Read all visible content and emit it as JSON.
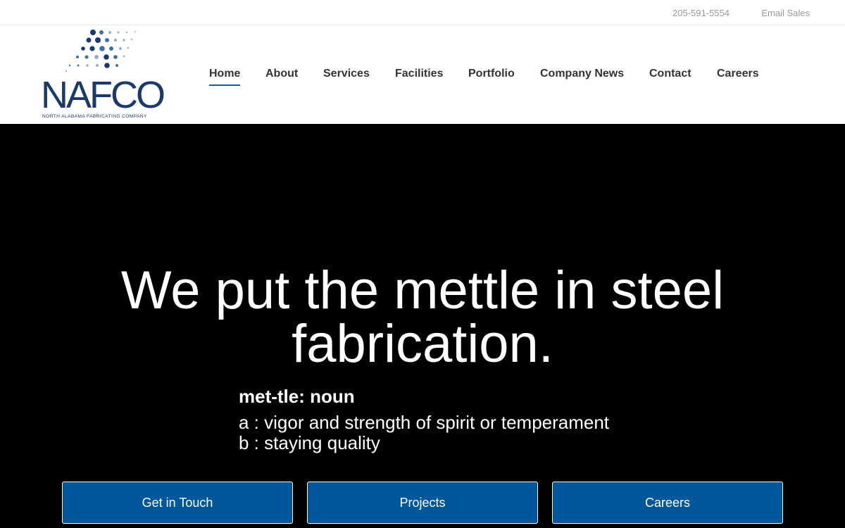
{
  "topbar": {
    "phone": "205-591-5554",
    "email": "Email Sales"
  },
  "logo": {
    "wordmark": "NAFCO",
    "tagline": "NORTH ALABAMA FABRICATING COMPANY",
    "icon": "dot-grid-logo-icon",
    "colors": {
      "dark": "#1a3a6b",
      "medium": "#3d6fa8",
      "light": "#8fb0d4"
    }
  },
  "nav": {
    "items": [
      {
        "label": "Home",
        "active": true
      },
      {
        "label": "About"
      },
      {
        "label": "Services"
      },
      {
        "label": "Facilities"
      },
      {
        "label": "Portfolio"
      },
      {
        "label": "Company News"
      },
      {
        "label": "Contact"
      },
      {
        "label": "Careers"
      }
    ]
  },
  "hero": {
    "headline_1": "We put the mettle in steel",
    "headline_2": "fabrication.",
    "term": "met-tle: noun",
    "def_a": "a : vigor and strength of spirit or temperament",
    "def_b": "b : staying quality"
  },
  "cta": {
    "get_in_touch": "Get in Touch",
    "projects": "Projects",
    "careers": "Careers"
  },
  "colors": {
    "accent": "#00579c",
    "nav_underline": "#1e5a8e",
    "hero_bg": "#000000"
  }
}
